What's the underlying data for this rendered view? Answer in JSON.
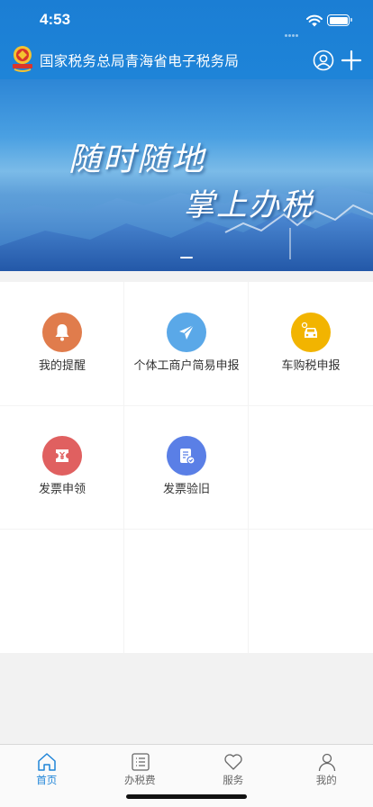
{
  "status_bar": {
    "time": "4:53"
  },
  "header": {
    "title": "国家税务总局青海省电子税务局"
  },
  "banner": {
    "slogan_line1": "随时随地",
    "slogan_line2": "掌上办税",
    "slides_shown": 1
  },
  "services": [
    {
      "label": "我的提醒",
      "icon": "bell-icon",
      "color": "#e07c4c"
    },
    {
      "label": "个体工商户简易申报",
      "icon": "paper-plane-icon",
      "color": "#5aa8e8"
    },
    {
      "label": "车购税申报",
      "icon": "car-icon",
      "color": "#f2b400"
    },
    {
      "label": "发票申领",
      "icon": "ticket-yen-icon",
      "color": "#e06060"
    },
    {
      "label": "发票验旧",
      "icon": "document-check-icon",
      "color": "#5a7fe6"
    }
  ],
  "tabbar": {
    "active_color": "#1e84d8",
    "items": [
      {
        "label": "首页",
        "icon": "home-icon",
        "active": true
      },
      {
        "label": "办税费",
        "icon": "list-icon",
        "active": false
      },
      {
        "label": "服务",
        "icon": "heart-icon",
        "active": false
      },
      {
        "label": "我的",
        "icon": "person-icon",
        "active": false
      }
    ]
  }
}
